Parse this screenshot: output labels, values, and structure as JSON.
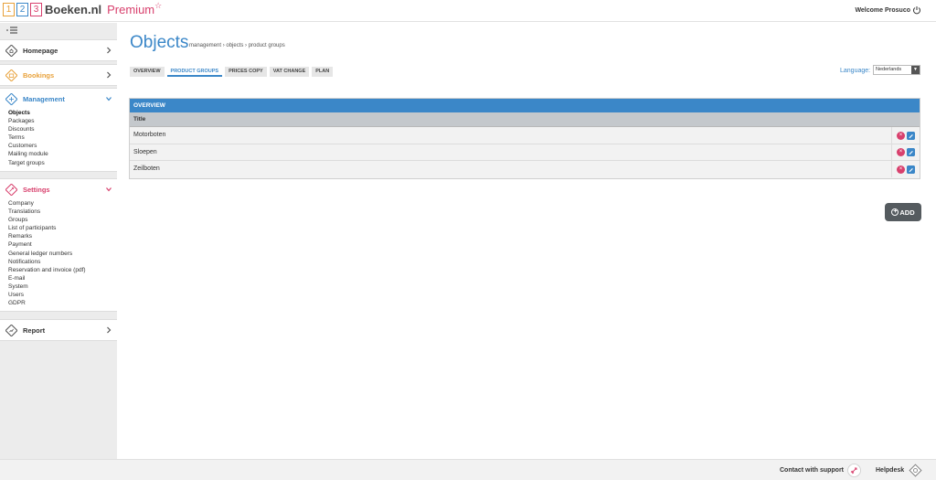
{
  "header": {
    "logo_digits": [
      "1",
      "2",
      "3"
    ],
    "logo_text": "Boeken.nl",
    "logo_premium": "Premium",
    "logo_star": "☆",
    "welcome": "Welcome Prosuco"
  },
  "sidebar": {
    "homepage": {
      "label": "Homepage"
    },
    "bookings": {
      "label": "Bookings"
    },
    "management": {
      "label": "Management",
      "items": [
        "Objects",
        "Packages",
        "Discounts",
        "Terms",
        "Customers",
        "Mailing module",
        "Target groups"
      ]
    },
    "settings": {
      "label": "Settings",
      "items": [
        "Company",
        "Translations",
        "Groups",
        "List of participants",
        "Remarks",
        "Payment",
        "General ledger numbers",
        "Notifications",
        "Reservation and invoice (pdf)",
        "E-mail",
        "System",
        "Users",
        "GDPR"
      ]
    },
    "report": {
      "label": "Report"
    }
  },
  "main": {
    "title": "Objects",
    "breadcrumb": "management › objects › product groups",
    "tabs": [
      "OVERVIEW",
      "PRODUCT GROUPS",
      "PRICES COPY",
      "VAT CHANGE",
      "PLAN"
    ],
    "active_tab": "PRODUCT GROUPS",
    "language_label": "Language:",
    "language_value": "Nederlands",
    "panel_title": "OVERVIEW",
    "column_title": "Title",
    "rows": [
      "Motorboten",
      "Sloepen",
      "Zeilboten"
    ],
    "add_label": "ADD"
  },
  "footer": {
    "support": "Contact with support",
    "helpdesk": "Helpdesk"
  },
  "colors": {
    "accent_blue": "#3b87c8",
    "bookings_orange": "#e8a13a",
    "settings_pink": "#d8406d"
  }
}
